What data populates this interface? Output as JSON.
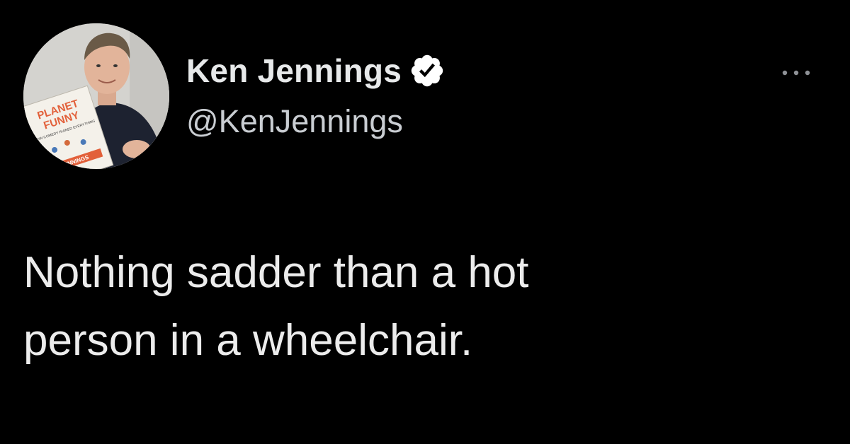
{
  "tweet": {
    "author": {
      "display_name": "Ken Jennings",
      "handle": "@KenJennings",
      "verified": true,
      "verified_icon": "verified-check-badge-icon",
      "avatar": {
        "book_title_line1": "PLANET",
        "book_title_line2": "FUNNY",
        "book_subtitle": "HOW COMEDY RUINED EVERYTHING",
        "book_author": "JENNINGS"
      }
    },
    "text_lines": [
      "Nothing sadder than a hot",
      "person in a wheelchair."
    ],
    "more_icon": "more-horizontal-icon"
  },
  "colors": {
    "background": "#000000",
    "text_primary": "#e7e9ea",
    "text_secondary": "#c9cdd2",
    "badge_fill": "#ffffff",
    "badge_check": "#000000"
  }
}
